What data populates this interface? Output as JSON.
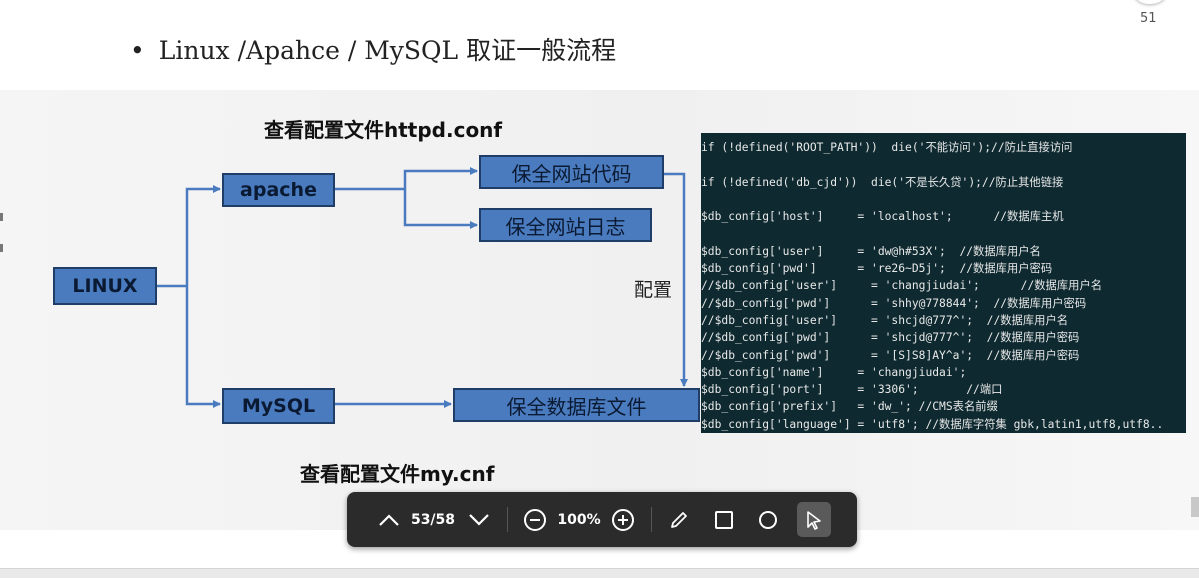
{
  "page_number": "51",
  "slide": {
    "bullet_dot": "•",
    "bullet_text": "Linux /Apahce / MySQL 取证一般流程",
    "heading_top": "查看配置文件httpd.conf",
    "heading_bottom": "查看配置文件my.cnf",
    "config_label": "配置",
    "boxes": {
      "linux": "LINUX",
      "apache": "apache",
      "mysql": "MySQL",
      "web_code": "保全网站代码",
      "web_log": "保全网站日志",
      "db_file": "保全数据库文件"
    },
    "code_lines": [
      "if (!defined('ROOT_PATH'))  die('不能访问');//防止直接访问",
      "",
      "if (!defined('db_cjd'))  die('不是长久贷');//防止其他链接",
      "",
      "$db_config['host']     = 'localhost';      //数据库主机",
      "",
      "$db_config['user']     = 'dw@h#53X';  //数据库用户名",
      "$db_config['pwd']      = 're26~D5j';  //数据库用户密码",
      "//$db_config['user']     = 'changjiudai';      //数据库用户名",
      "//$db_config['pwd']      = 'shhy@778844';  //数据库用户密码",
      "//$db_config['user']     = 'shcjd@777^';  //数据库用户名",
      "//$db_config['pwd']      = 'shcjd@777^';  //数据库用户密码",
      "//$db_config['pwd']      = '[S]S8]AY^a';  //数据库用户密码",
      "$db_config['name']     = 'changjiudai';",
      "$db_config['port']     = '3306';       //端口",
      "$db_config['prefix']   = 'dw_'; //CMS表名前缀",
      "$db_config['language'] = 'utf8'; //数据库字符集 gbk,latin1,utf8,utf8.."
    ]
  },
  "toolbar": {
    "page_indicator": "53/58",
    "zoom_level": "100%",
    "icons": {
      "prev": "chevron-up-icon",
      "next": "chevron-down-icon",
      "zoom_out": "zoom-out-icon",
      "zoom_in": "zoom-in-icon",
      "pen": "pen-icon",
      "rect": "rectangle-icon",
      "circle": "circle-icon",
      "pointer": "pointer-icon"
    }
  },
  "colors": {
    "box_fill": "#4a7bbf",
    "box_border": "#1f3d66",
    "code_bg": "#0e2a30",
    "toolbar_bg": "#2b2b2b"
  }
}
